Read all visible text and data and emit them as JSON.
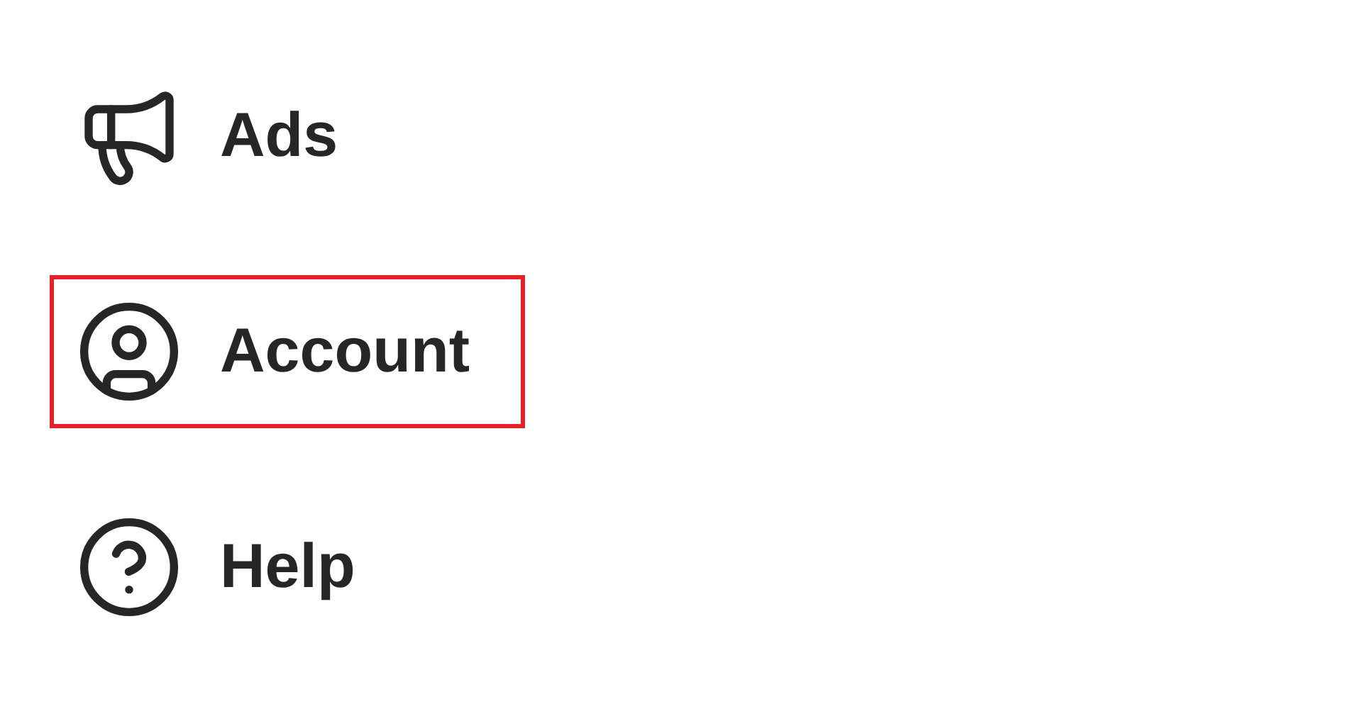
{
  "menu": {
    "items": [
      {
        "kind": "megaphone",
        "label": "Ads",
        "highlighted": false
      },
      {
        "kind": "account",
        "label": "Account",
        "highlighted": true
      },
      {
        "kind": "help",
        "label": "Help",
        "highlighted": false
      }
    ]
  }
}
